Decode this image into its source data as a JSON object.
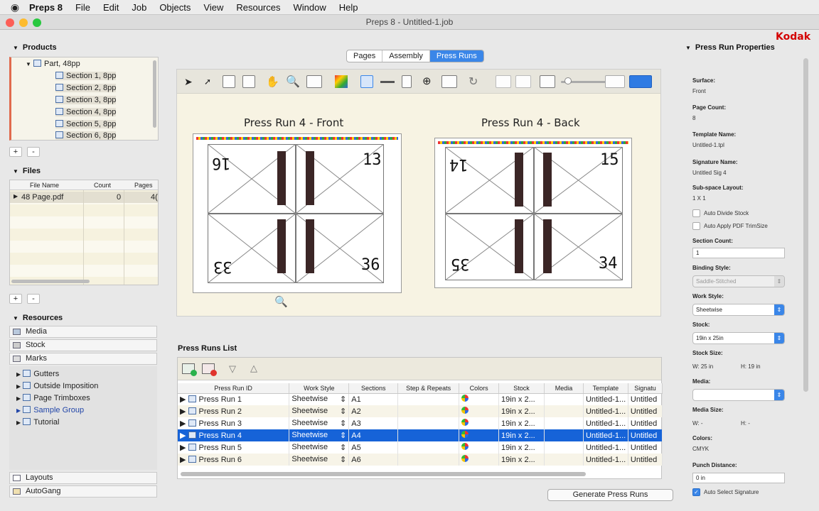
{
  "menubar": {
    "apple": "",
    "app": "Preps 8",
    "items": [
      "File",
      "Edit",
      "Job",
      "Objects",
      "View",
      "Resources",
      "Window",
      "Help"
    ]
  },
  "window": {
    "title": "Preps 8 - Untitled-1.job",
    "brand": "Kodak"
  },
  "products": {
    "header": "Products",
    "items": [
      "Part, 48pp",
      "Section 1, 8pp",
      "Section 2, 8pp",
      "Section 3, 8pp",
      "Section 4, 8pp",
      "Section 5, 8pp",
      "Section 6, 8pp"
    ],
    "add": "+",
    "remove": "-"
  },
  "files": {
    "header": "Files",
    "columns": [
      "File Name",
      "Count",
      "Pages"
    ],
    "rows": [
      {
        "name": "48 Page.pdf",
        "count": "0",
        "pages": "4("
      }
    ],
    "add": "+",
    "remove": "-"
  },
  "resources": {
    "header": "Resources",
    "items": [
      "Media",
      "Stock",
      "Marks"
    ],
    "tree": [
      "Gutters",
      "Outside Imposition",
      "Page Trimboxes",
      "Sample Group",
      "Tutorial"
    ],
    "bottom": [
      "Layouts",
      "AutoGang"
    ]
  },
  "tabs": [
    "Pages",
    "Assembly",
    "Press Runs"
  ],
  "editor": {
    "front_title": "Press Run 4 - Front",
    "back_title": "Press Run 4 - Back",
    "front_pages": [
      "16",
      "13",
      "33",
      "36"
    ],
    "back_pages": [
      "14",
      "15",
      "35",
      "34"
    ]
  },
  "press_runs_list": {
    "header": "Press Runs List",
    "columns": [
      "Press Run ID",
      "Work Style",
      "Sections",
      "Step & Repeats",
      "Colors",
      "Stock",
      "Media",
      "Template",
      "Signatu"
    ],
    "rows": [
      {
        "id": "Press Run 1",
        "style": "Sheetwise",
        "sections": "A1",
        "stock": "19in x 2...",
        "template": "Untitled-1...",
        "sig": "Untitled"
      },
      {
        "id": "Press Run 2",
        "style": "Sheetwise",
        "sections": "A2",
        "stock": "19in x 2...",
        "template": "Untitled-1...",
        "sig": "Untitled"
      },
      {
        "id": "Press Run 3",
        "style": "Sheetwise",
        "sections": "A3",
        "stock": "19in x 2...",
        "template": "Untitled-1...",
        "sig": "Untitled"
      },
      {
        "id": "Press Run 4",
        "style": "Sheetwise",
        "sections": "A4",
        "stock": "19in x 2...",
        "template": "Untitled-1...",
        "sig": "Untitled"
      },
      {
        "id": "Press Run 5",
        "style": "Sheetwise",
        "sections": "A5",
        "stock": "19in x 2...",
        "template": "Untitled-1...",
        "sig": "Untitled"
      },
      {
        "id": "Press Run 6",
        "style": "Sheetwise",
        "sections": "A6",
        "stock": "19in x 2...",
        "template": "Untitled-1...",
        "sig": "Untitled"
      }
    ],
    "selected_index": 3,
    "generate_button": "Generate Press Runs"
  },
  "properties": {
    "header": "Press Run Properties",
    "surface_label": "Surface:",
    "surface": "Front",
    "page_count_label": "Page Count:",
    "page_count": "8",
    "template_label": "Template Name:",
    "template": "Untitled-1.tpl",
    "signature_label": "Signature Name:",
    "signature": "Untitled Sig 4",
    "subspace_label": "Sub-space Layout:",
    "subspace": "1 X 1",
    "auto_divide": "Auto Divide Stock",
    "auto_apply": "Auto Apply PDF TrimSize",
    "section_count_label": "Section Count:",
    "section_count": "1",
    "binding_label": "Binding Style:",
    "binding": "Saddle-Stitched",
    "work_style_label": "Work Style:",
    "work_style": "Sheetwise",
    "stock_label": "Stock:",
    "stock": "19in x 25in",
    "stock_size_label": "Stock Size:",
    "stock_w": "W: 25 in",
    "stock_h": "H: 19 in",
    "media_label": "Media:",
    "media": "",
    "media_size_label": "Media Size:",
    "media_w": "W: -",
    "media_h": "H: -",
    "colors_label": "Colors:",
    "colors": "CMYK",
    "punch_label": "Punch Distance:",
    "punch": "0 in",
    "auto_select": "Auto Select Signature"
  }
}
